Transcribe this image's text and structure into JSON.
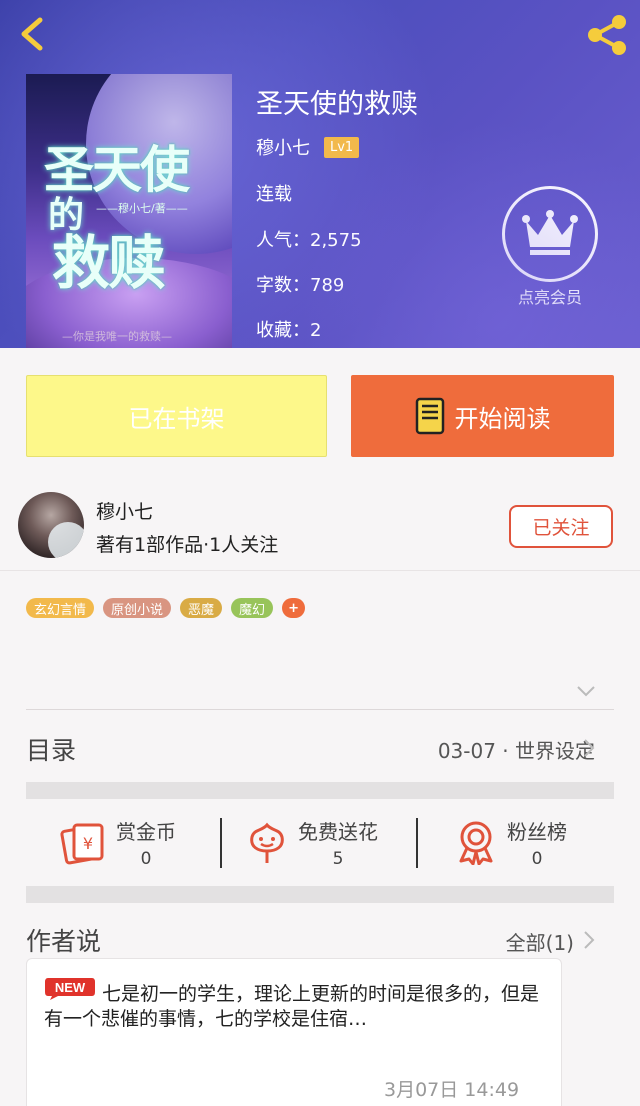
{
  "header": {
    "title": "圣天使的救赎",
    "author": "穆小七",
    "level_badge": "Lv1",
    "status": "连载",
    "popularity": "人气：2,575",
    "word_count": "字数：789",
    "favorites": "收藏：2",
    "vip_label": "点亮会员",
    "cover": {
      "line1": "圣天使",
      "line2": "的",
      "line3": "救赎",
      "author_line": "——穆小七/著——",
      "tagline": "—你是我唯一的救赎—"
    }
  },
  "actions": {
    "shelf_label": "已在书架",
    "read_label": "开始阅读"
  },
  "author_section": {
    "name": "穆小七",
    "meta": "著有1部作品·1人关注",
    "follow_label": "已关注"
  },
  "tags": [
    {
      "label": "玄幻言情",
      "color": "#f2b94b"
    },
    {
      "label": "原创小说",
      "color": "#d99581"
    },
    {
      "label": "恶魔",
      "color": "#d9ab45"
    },
    {
      "label": "魔幻",
      "color": "#98c45a"
    },
    {
      "label": "+",
      "color": "#ef6c3c"
    }
  ],
  "toc": {
    "label": "目录",
    "latest": "03-07 · 世界设定"
  },
  "stats": [
    {
      "label": "赏金币",
      "value": "0",
      "icon": "gold-coin-icon"
    },
    {
      "label": "免费送花",
      "value": "5",
      "icon": "flower-icon"
    },
    {
      "label": "粉丝榜",
      "value": "0",
      "icon": "medal-icon"
    }
  ],
  "author_says": {
    "label": "作者说",
    "all_label": "全部(1)",
    "new_badge": "NEW",
    "text": "七是初一的学生，理论上更新的时间是很多的，但是有一个悲催的事情，七的学校是住宿…",
    "time": "3月07日  14:49"
  },
  "colors": {
    "accent": "#ef6c3c",
    "follow_red": "#e0533b",
    "shelf_yellow": "#fdf88a",
    "badge_gold": "#f2b94b"
  }
}
